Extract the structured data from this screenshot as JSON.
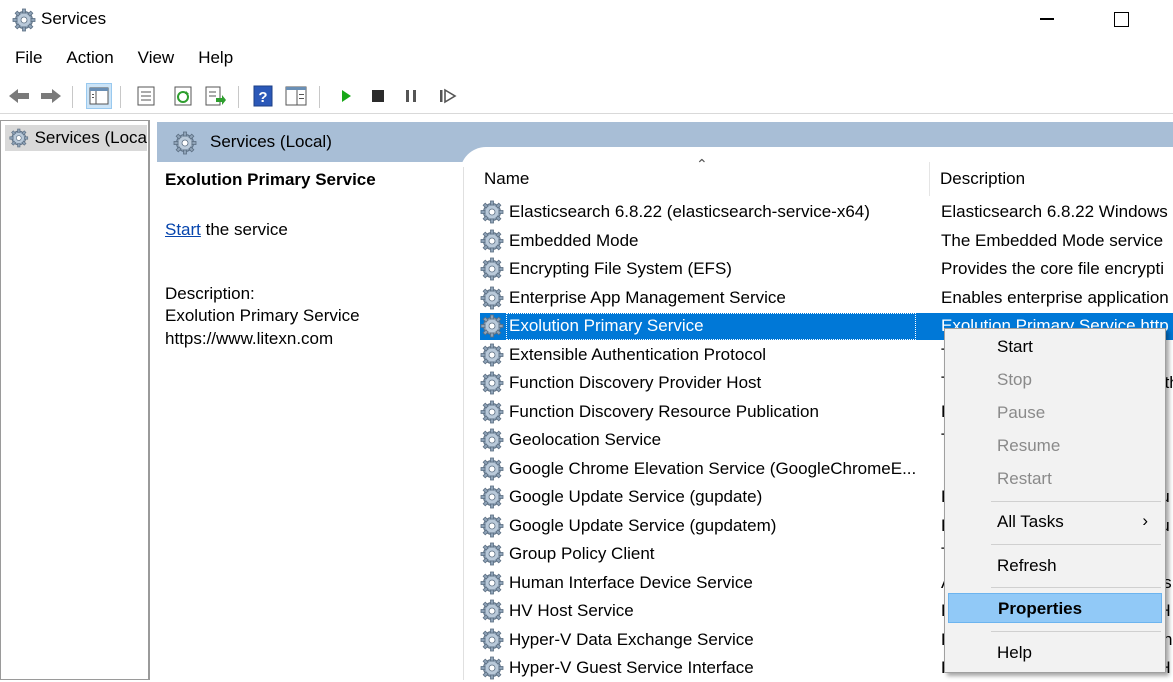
{
  "window": {
    "title": "Services"
  },
  "menu": [
    "File",
    "Action",
    "View",
    "Help"
  ],
  "tree": {
    "root_label": "Services (Loca"
  },
  "header": {
    "title": "Services (Local)"
  },
  "details": {
    "service_name": "Exolution Primary Service",
    "start_link": "Start",
    "start_suffix": " the service",
    "description_label": "Description:",
    "description_line1": "Exolution Primary Service",
    "description_line2": "https://www.litexn.com"
  },
  "table": {
    "columns": [
      "Name",
      "Description"
    ],
    "rows": [
      {
        "name": "Elasticsearch 6.8.22 (elasticsearch-service-x64)",
        "description": "Elasticsearch 6.8.22 Windows"
      },
      {
        "name": "Embedded Mode",
        "description": "The Embedded Mode service"
      },
      {
        "name": "Encrypting File System (EFS)",
        "description": "Provides the core file encrypti"
      },
      {
        "name": "Enterprise App Management Service",
        "description": "Enables enterprise application"
      },
      {
        "name": "Exolution Primary Service",
        "description": "Exolution Primary Service http"
      },
      {
        "name": "Extensible Authentication Protocol",
        "description": "The Extensible Authentication"
      },
      {
        "name": "Function Discovery Provider Host",
        "description": "The FDPHOST service hosts th"
      },
      {
        "name": "Function Discovery Resource Publication",
        "description": "Publishes this computer and r"
      },
      {
        "name": "Geolocation Service",
        "description": "This service monitors the curr"
      },
      {
        "name": "Google Chrome Elevation Service (GoogleChromeE...",
        "description": ""
      },
      {
        "name": "Google Update Service (gupdate)",
        "description": "Keeps your Google software u"
      },
      {
        "name": "Google Update Service (gupdatem)",
        "description": "Keeps your Google software u"
      },
      {
        "name": "Group Policy Client",
        "description": "The service is responsible for"
      },
      {
        "name": "Human Interface Device Service",
        "description": "Activates and maintains the us"
      },
      {
        "name": "HV Host Service",
        "description": "Provides an interface for the H"
      },
      {
        "name": "Hyper-V Data Exchange Service",
        "description": "Provides a mechanism to exch"
      },
      {
        "name": "Hyper-V Guest Service Interface",
        "description": "Provides an interface for the H"
      }
    ]
  },
  "context_menu": {
    "start": "Start",
    "stop": "Stop",
    "pause": "Pause",
    "resume": "Resume",
    "restart": "Restart",
    "all_tasks": "All Tasks",
    "submenu_arrow": "›",
    "refresh": "Refresh",
    "properties": "Properties",
    "help": "Help"
  },
  "colors": {
    "selection": "#0078d7",
    "header_bar": "#a8bed6",
    "highlight": "#91c9f7"
  }
}
